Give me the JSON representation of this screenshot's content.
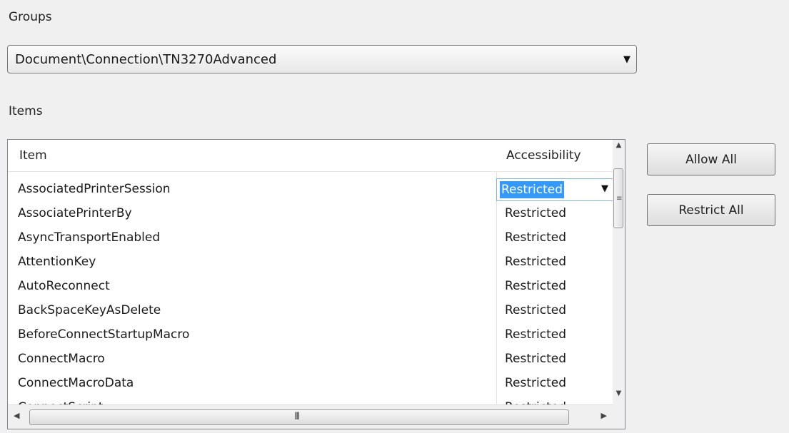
{
  "groups": {
    "label": "Groups",
    "selected": "Document\\Connection\\TN3270Advanced"
  },
  "items": {
    "label": "Items",
    "columns": [
      "Item",
      "Accessibility"
    ],
    "rows": [
      {
        "name": "AssociatedPrinterSession",
        "access": "Restricted"
      },
      {
        "name": "AssociatePrinterBy",
        "access": "Restricted"
      },
      {
        "name": "AsyncTransportEnabled",
        "access": "Restricted"
      },
      {
        "name": "AttentionKey",
        "access": "Restricted"
      },
      {
        "name": "AutoReconnect",
        "access": "Restricted"
      },
      {
        "name": "BackSpaceKeyAsDelete",
        "access": "Restricted"
      },
      {
        "name": "BeforeConnectStartupMacro",
        "access": "Restricted"
      },
      {
        "name": "ConnectMacro",
        "access": "Restricted"
      },
      {
        "name": "ConnectMacroData",
        "access": "Restricted"
      },
      {
        "name": "ConnectScript",
        "access": "Restricted"
      }
    ],
    "editing_row": 0,
    "scrollbar_grip": "III"
  },
  "buttons": {
    "allow_all": "Allow All",
    "restrict_all": "Restrict All"
  },
  "colors": {
    "selection": "#3399ff",
    "background": "#f0f0f0"
  }
}
